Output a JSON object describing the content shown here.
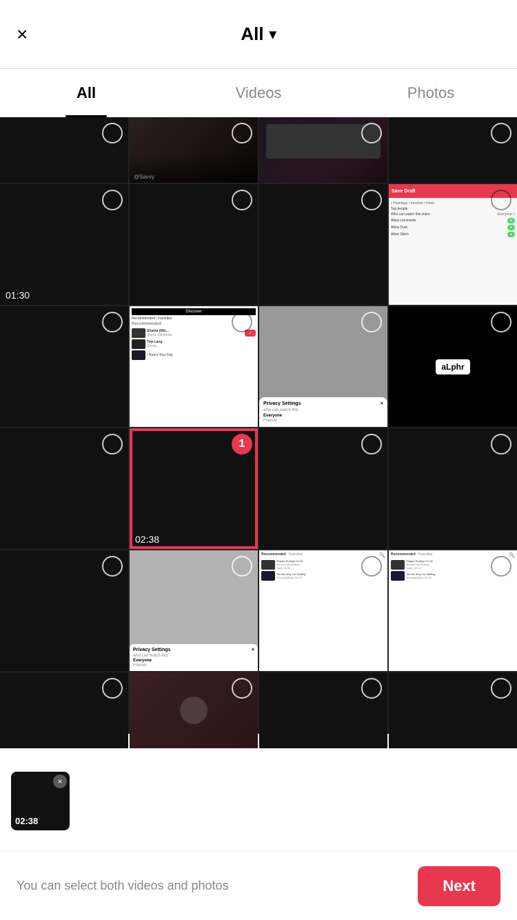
{
  "header": {
    "close_label": "×",
    "title": "All",
    "chevron": "▾"
  },
  "tabs": [
    {
      "id": "all",
      "label": "All",
      "active": true
    },
    {
      "id": "videos",
      "label": "Videos",
      "active": false
    },
    {
      "id": "photos",
      "label": "Photos",
      "active": false
    }
  ],
  "grid": {
    "rows": [
      [
        {
          "type": "dark",
          "duration": null,
          "selected": false,
          "badge": null
        },
        {
          "type": "person",
          "duration": null,
          "selected": false,
          "badge": null
        },
        {
          "type": "person2",
          "duration": null,
          "selected": false,
          "badge": null
        },
        {
          "type": "dark",
          "duration": null,
          "selected": false,
          "badge": null
        }
      ],
      [
        {
          "type": "dark",
          "duration": "01:30",
          "selected": false,
          "badge": null
        },
        {
          "type": "dark",
          "duration": null,
          "selected": false,
          "badge": null
        },
        {
          "type": "dark",
          "duration": null,
          "selected": false,
          "badge": null
        },
        {
          "type": "ui_screen",
          "duration": null,
          "selected": false,
          "badge": null
        }
      ],
      [
        {
          "type": "dark",
          "duration": null,
          "selected": false,
          "badge": null
        },
        {
          "type": "discover_ui",
          "duration": null,
          "selected": false,
          "badge": null
        },
        {
          "type": "privacy_ui",
          "duration": null,
          "selected": false,
          "badge": null
        },
        {
          "type": "alphr",
          "duration": null,
          "selected": false,
          "badge": null
        }
      ],
      [
        {
          "type": "dark",
          "duration": null,
          "selected": false,
          "badge": null
        },
        {
          "type": "selected_video",
          "duration": "02:38",
          "selected": true,
          "badge": "1"
        },
        {
          "type": "dark",
          "duration": null,
          "selected": false,
          "badge": null
        },
        {
          "type": "dark",
          "duration": null,
          "selected": false,
          "badge": null
        }
      ],
      [
        {
          "type": "dark",
          "duration": null,
          "selected": false,
          "badge": null
        },
        {
          "type": "privacy_ui2",
          "duration": null,
          "selected": false,
          "badge": null
        },
        {
          "type": "recommended_ui",
          "duration": null,
          "selected": false,
          "badge": null
        },
        {
          "type": "recommended_ui2",
          "duration": null,
          "selected": false,
          "badge": null
        }
      ],
      [
        {
          "type": "dark",
          "duration": null,
          "selected": false,
          "badge": null
        },
        {
          "type": "person3",
          "duration": null,
          "selected": false,
          "badge": null
        },
        {
          "type": "dark",
          "duration": null,
          "selected": false,
          "badge": null
        },
        {
          "type": "dark",
          "duration": null,
          "selected": false,
          "badge": null
        }
      ]
    ]
  },
  "selected_preview": {
    "duration": "02:38",
    "close_icon": "×"
  },
  "bottom_bar": {
    "hint": "You can select both videos and photos",
    "next_button": "Next"
  }
}
